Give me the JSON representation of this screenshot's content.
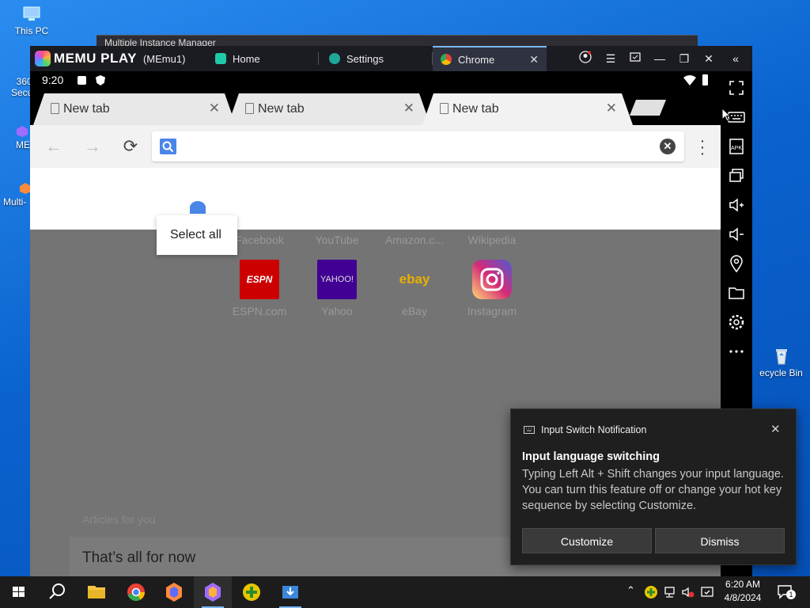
{
  "desktop": {
    "icons": [
      "This PC",
      "360\nSecu",
      "ME",
      "Multi-",
      "ecycle Bin"
    ]
  },
  "bg_window": {
    "title": "Multiple Instance Manager"
  },
  "memu": {
    "brand": "MEMU PLAY",
    "instance": "(MEmu1)",
    "tabs": [
      {
        "label": "Home",
        "color": "#1fc9a8"
      },
      {
        "label": "Settings",
        "color": "#1fa89a"
      },
      {
        "label": "Chrome",
        "color": "#ffffff"
      }
    ],
    "controls": [
      "account-icon",
      "menu-icon",
      "screen-icon",
      "minimize-icon",
      "restore-icon",
      "close-icon",
      "collapse-icon"
    ]
  },
  "android_status": {
    "time": "9:20"
  },
  "sidebar_tools": [
    "fullscreen-icon",
    "keyboard-icon",
    "apk-icon",
    "multi-window-icon",
    "volume-up-icon",
    "volume-down-icon",
    "location-icon",
    "folder-icon",
    "gear-icon",
    "more-icon"
  ],
  "chrome": {
    "tabs": [
      {
        "label": "New tab"
      },
      {
        "label": "New tab"
      },
      {
        "label": "New tab"
      }
    ],
    "omnibox_value": "",
    "popup": "Select all",
    "sites_row1": [
      "Facebook",
      "YouTube",
      "Amazon.c...",
      "Wikipedia"
    ],
    "sites_row2": [
      {
        "label": "ESPN.com",
        "tile": "ESPN",
        "color": "#cc0000"
      },
      {
        "label": "Yahoo",
        "tile": "YAHOO!",
        "color": "#410093"
      },
      {
        "label": "eBay",
        "tile": "ebay",
        "color": "#f2f2f2"
      },
      {
        "label": "Instagram",
        "tile": "",
        "color": "#c13584"
      }
    ],
    "articles_heading": "Articles for you",
    "all_for_now": "That’s all for now"
  },
  "toast": {
    "header": "Input Switch Notification",
    "title": "Input language switching",
    "body": "Typing Left Alt + Shift changes your input language. You can turn this feature off or change your hot key sequence by selecting Customize.",
    "customize": "Customize",
    "dismiss": "Dismiss"
  },
  "taskbar": {
    "clock_time": "6:20 AM",
    "clock_date": "4/8/2024",
    "notifications": "1"
  }
}
